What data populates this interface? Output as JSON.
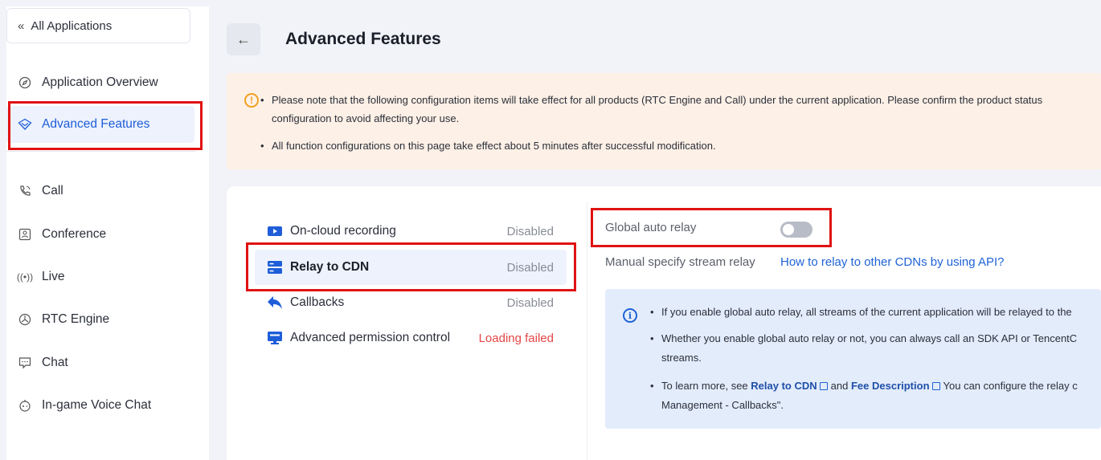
{
  "sidebar": {
    "all_apps": "All Applications",
    "items": [
      {
        "label": "Application Overview",
        "icon": "compass-icon"
      },
      {
        "label": "Advanced Features",
        "icon": "shield-icon",
        "active": true
      },
      {
        "label": "Call",
        "icon": "phone-icon"
      },
      {
        "label": "Conference",
        "icon": "conference-icon"
      },
      {
        "label": "Live",
        "icon": "broadcast-icon"
      },
      {
        "label": "RTC Engine",
        "icon": "rtc-icon"
      },
      {
        "label": "Chat",
        "icon": "chat-icon"
      },
      {
        "label": "In-game Voice Chat",
        "icon": "gamepad-icon"
      }
    ]
  },
  "header": {
    "title": "Advanced Features"
  },
  "notice": {
    "line1": "Please note that the following configuration items will take effect for all products (RTC Engine and Call) under the current application. Please confirm the product status",
    "line2": "configuration to avoid affecting your use.",
    "line3": "All function configurations on this page take effect about 5 minutes after successful modification."
  },
  "features": [
    {
      "label": "On-cloud recording",
      "status": "Disabled",
      "icon": "video-icon"
    },
    {
      "label": "Relay to CDN",
      "status": "Disabled",
      "icon": "server-icon",
      "active": true
    },
    {
      "label": "Callbacks",
      "status": "Disabled",
      "icon": "reply-icon"
    },
    {
      "label": "Advanced permission control",
      "status": "Loading failed",
      "icon": "monitor-icon"
    }
  ],
  "relay": {
    "global_auto_relay_label": "Global auto relay",
    "global_auto_relay_enabled": false,
    "manual_label": "Manual specify stream relay",
    "api_link": "How to relay to other CDNs by using API?",
    "info": {
      "line1": "If you enable global auto relay, all streams of the current application will be relayed to the",
      "line2": "Whether you enable global auto relay or not, you can always call an SDK API or TencentC",
      "line2b": "streams.",
      "line3_pre": "To learn more, see",
      "link1": "Relay to CDN",
      "line3_and": "and",
      "link2": "Fee Description",
      "line3_post": "You can configure the relay c",
      "line3b": "Management - Callbacks\"."
    }
  },
  "colors": {
    "accent": "#1f63d6",
    "highlight_box": "#e01212",
    "error": "#e54545",
    "notice_bg": "#fdf0e6",
    "info_bg": "#e3ecfb"
  }
}
